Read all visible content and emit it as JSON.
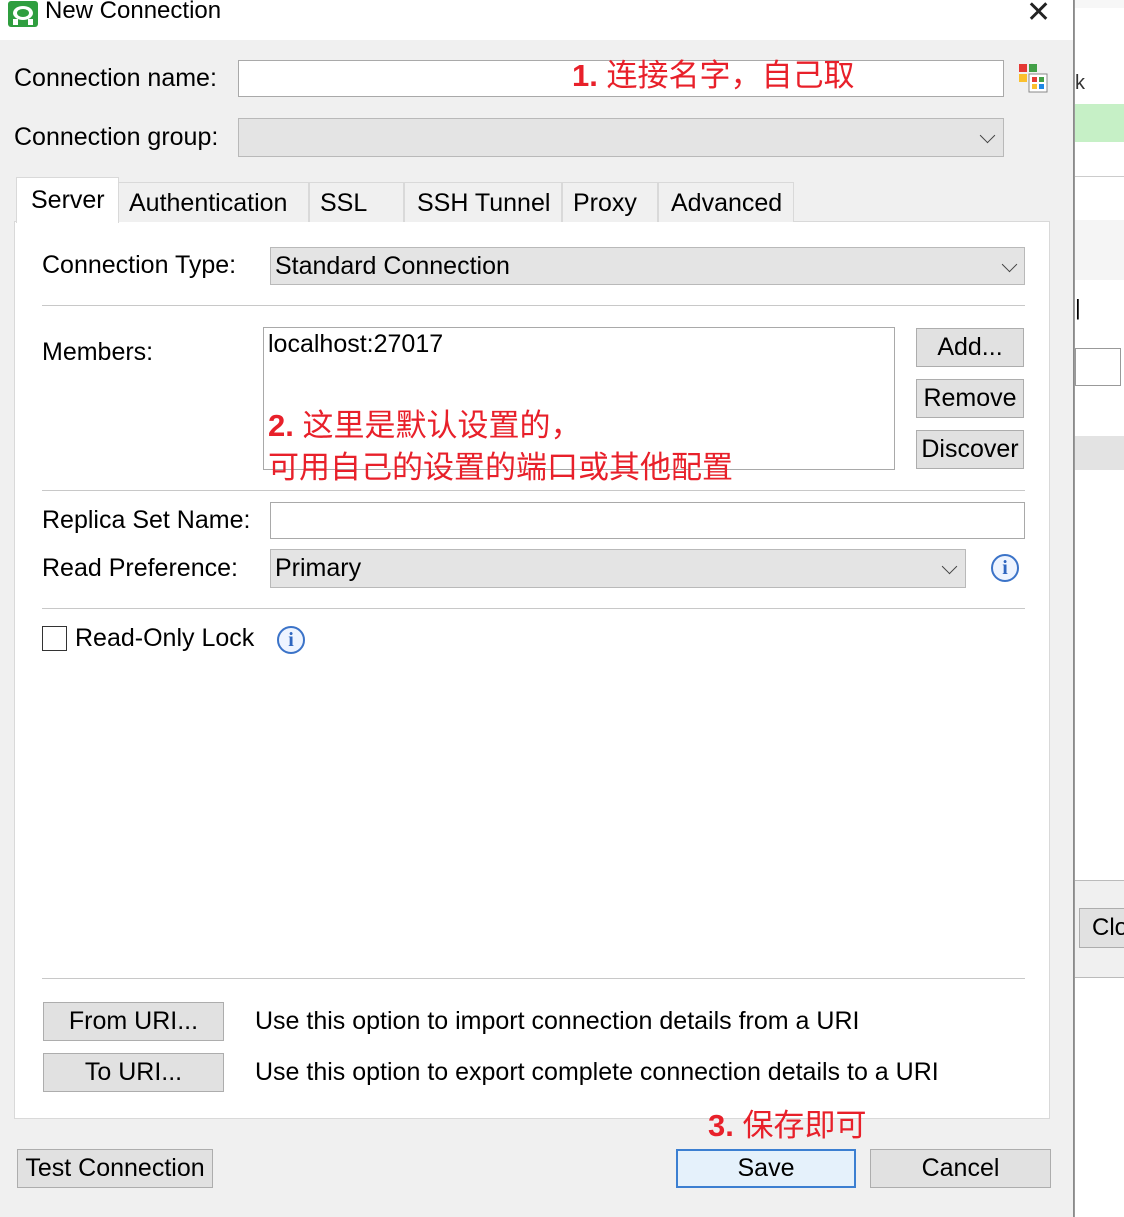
{
  "window": {
    "title": "New Connection",
    "close_glyph": "✕"
  },
  "form": {
    "connection_name_label": "Connection name:",
    "connection_name_value": "",
    "connection_group_label": "Connection group:",
    "connection_group_value": ""
  },
  "tabs": [
    {
      "label": "Server",
      "active": true
    },
    {
      "label": "Authentication"
    },
    {
      "label": "SSL"
    },
    {
      "label": "SSH Tunnel"
    },
    {
      "label": "Proxy"
    },
    {
      "label": "Advanced"
    }
  ],
  "server": {
    "connection_type_label": "Connection Type:",
    "connection_type_value": "Standard Connection",
    "members_label": "Members:",
    "members_value": "localhost:27017",
    "add_button": "Add...",
    "remove_button": "Remove",
    "discover_button": "Discover",
    "replica_set_label": "Replica Set Name:",
    "replica_set_value": "",
    "read_preference_label": "Read Preference:",
    "read_preference_value": "Primary",
    "readonly_lock_label": "Read-Only Lock",
    "readonly_lock_checked": false
  },
  "uri": {
    "from_button": "From URI...",
    "from_text": "Use this option to import connection details from a URI",
    "to_button": "To URI...",
    "to_text": "Use this option to export complete connection details to a URI"
  },
  "footer": {
    "test_button": "Test Connection",
    "save_button": "Save",
    "cancel_button": "Cancel"
  },
  "annotations": {
    "step1_num": "1.",
    "step1_text": "连接名字，自己取",
    "step2_num": "2.",
    "step2_line1": "这里是默认设置的，",
    "step2_line2": "可用自己的设置的端口或其他配置",
    "step3_num": "3.",
    "step3_text": "保存即可"
  },
  "background_window": {
    "partial_button": "Clo"
  },
  "colors": {
    "annotation": "#e8202a",
    "save_border": "#3c7fd1",
    "info_icon": "#3b73c8"
  }
}
